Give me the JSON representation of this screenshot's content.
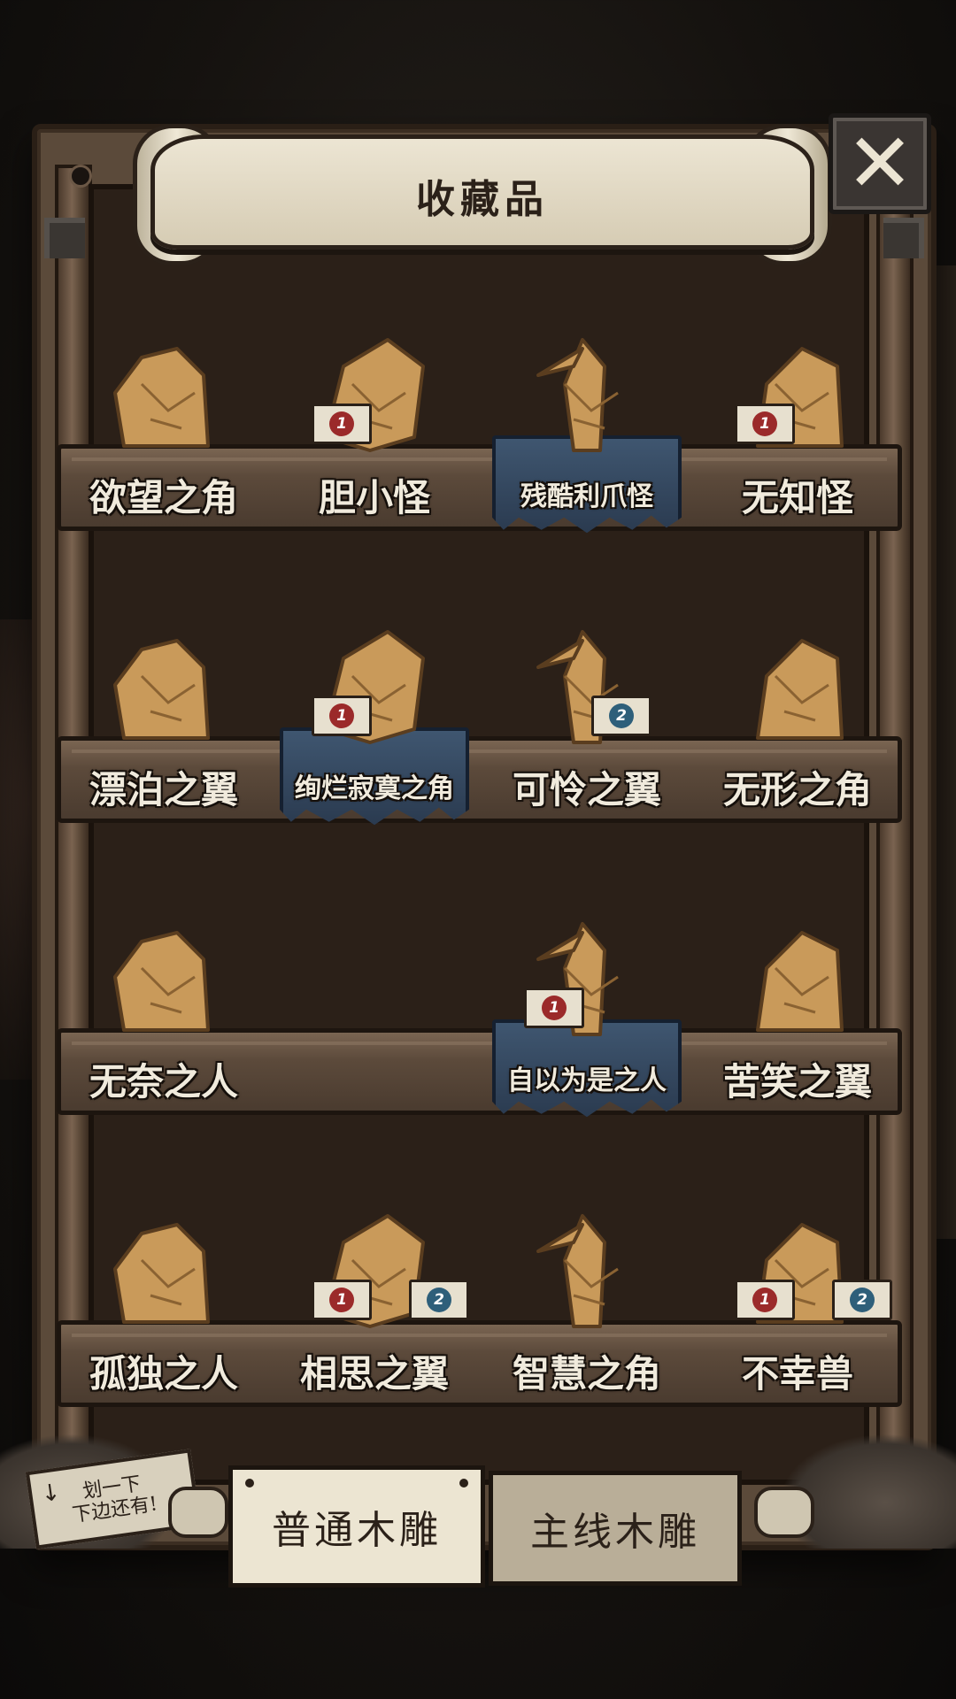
{
  "title": "收藏品",
  "close_icon": "close-icon",
  "shelves": [
    {
      "items": [
        {
          "name": "欲望之角",
          "featured": false,
          "badges": []
        },
        {
          "name": "胆小怪",
          "featured": false,
          "badges": [
            "1"
          ]
        },
        {
          "name": "残酷利爪怪",
          "featured": true,
          "badges": []
        },
        {
          "name": "无知怪",
          "featured": false,
          "badges": [
            "1"
          ]
        }
      ]
    },
    {
      "items": [
        {
          "name": "漂泊之翼",
          "featured": false,
          "badges": []
        },
        {
          "name": "绚烂寂寞之角",
          "featured": true,
          "badges": [
            "1"
          ]
        },
        {
          "name": "可怜之翼",
          "featured": false,
          "badges": [
            "2"
          ]
        },
        {
          "name": "无形之角",
          "featured": false,
          "badges": []
        }
      ]
    },
    {
      "items": [
        {
          "name": "无奈之人",
          "featured": false,
          "badges": []
        },
        {
          "name": "",
          "featured": false,
          "badges": []
        },
        {
          "name": "自以为是之人",
          "featured": true,
          "badges": [
            "1"
          ]
        },
        {
          "name": "苦笑之翼",
          "featured": false,
          "badges": []
        }
      ]
    },
    {
      "items": [
        {
          "name": "孤独之人",
          "featured": false,
          "badges": []
        },
        {
          "name": "相思之翼",
          "featured": false,
          "badges": [
            "1",
            "2"
          ]
        },
        {
          "name": "智慧之角",
          "featured": false,
          "badges": []
        },
        {
          "name": "不幸兽",
          "featured": false,
          "badges": [
            "1",
            "2"
          ]
        }
      ]
    }
  ],
  "swipe_hint": {
    "line1": "划一下",
    "line2": "下边还有!"
  },
  "tabs": {
    "common": "普通木雕",
    "main": "主线木雕"
  },
  "colors": {
    "wood": "#c99a5a",
    "pedestal": "#3f5670",
    "badge_red": "#9b2a2a",
    "badge_blue": "#2e5f7a"
  }
}
